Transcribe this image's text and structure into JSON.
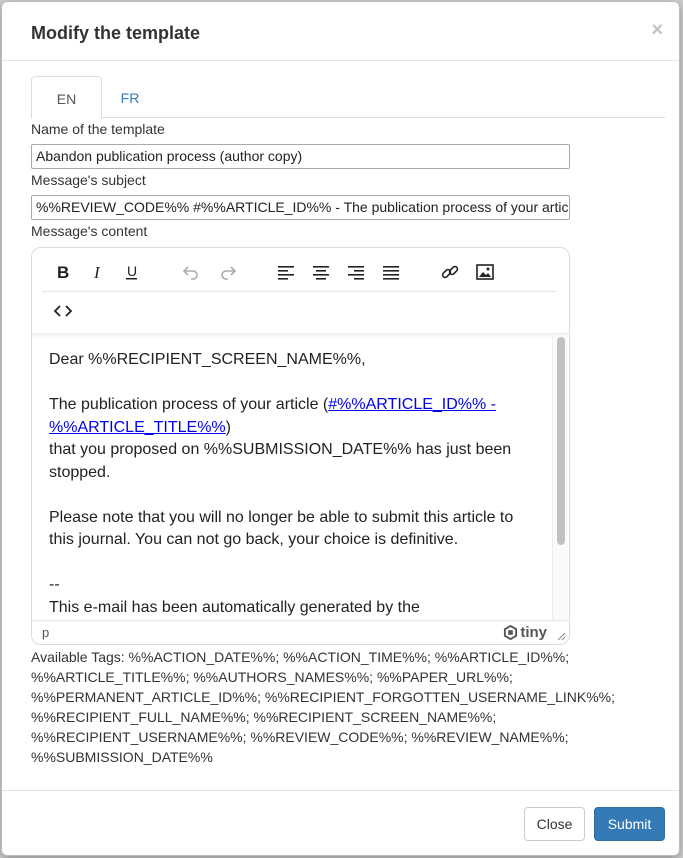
{
  "modal": {
    "title": "Modify the template",
    "close_symbol": "×"
  },
  "tabs": [
    {
      "label": "EN",
      "active": true
    },
    {
      "label": "FR",
      "active": false
    }
  ],
  "fields": {
    "name_label": "Name of the template",
    "name_value": "Abandon publication process (author copy)",
    "subject_label": "Message's subject",
    "subject_value": "%%REVIEW_CODE%% #%%ARTICLE_ID%% - The publication process of your article has just been stopped",
    "content_label": "Message's content"
  },
  "toolbar": {
    "icons": [
      "bold-icon",
      "italic-icon",
      "underline-icon",
      "undo-icon",
      "redo-icon",
      "align-left-icon",
      "align-center-icon",
      "align-right-icon",
      "justify-icon",
      "link-icon",
      "image-icon",
      "source-code-icon"
    ]
  },
  "editor": {
    "greeting": "Dear %%RECIPIENT_SCREEN_NAME%%,",
    "para1_before": "The publication process of your article (",
    "para1_link": "#%%ARTICLE_ID%% - %%ARTICLE_TITLE%%",
    "para1_after": ")",
    "para1_line2": "that you proposed on %%SUBMISSION_DATE%% has just been stopped.",
    "para2": "Please note that you will no longer be able to submit this article to this journal. You can not go back, your choice is definitive.",
    "sig_dash": "--",
    "sig_line": "This e-mail has been automatically generated by the",
    "status_path": "p",
    "brand": "tiny"
  },
  "available_tags": "Available Tags: %%ACTION_DATE%%; %%ACTION_TIME%%; %%ARTICLE_ID%%; %%ARTICLE_TITLE%%; %%AUTHORS_NAMES%%; %%PAPER_URL%%; %%PERMANENT_ARTICLE_ID%%; %%RECIPIENT_FORGOTTEN_USERNAME_LINK%%; %%RECIPIENT_FULL_NAME%%; %%RECIPIENT_SCREEN_NAME%%; %%RECIPIENT_USERNAME%%; %%REVIEW_CODE%%; %%REVIEW_NAME%%; %%SUBMISSION_DATE%%",
  "buttons": {
    "close": "Close",
    "submit": "Submit"
  },
  "colors": {
    "primary": "#337ab7",
    "link": "#337ab7"
  }
}
